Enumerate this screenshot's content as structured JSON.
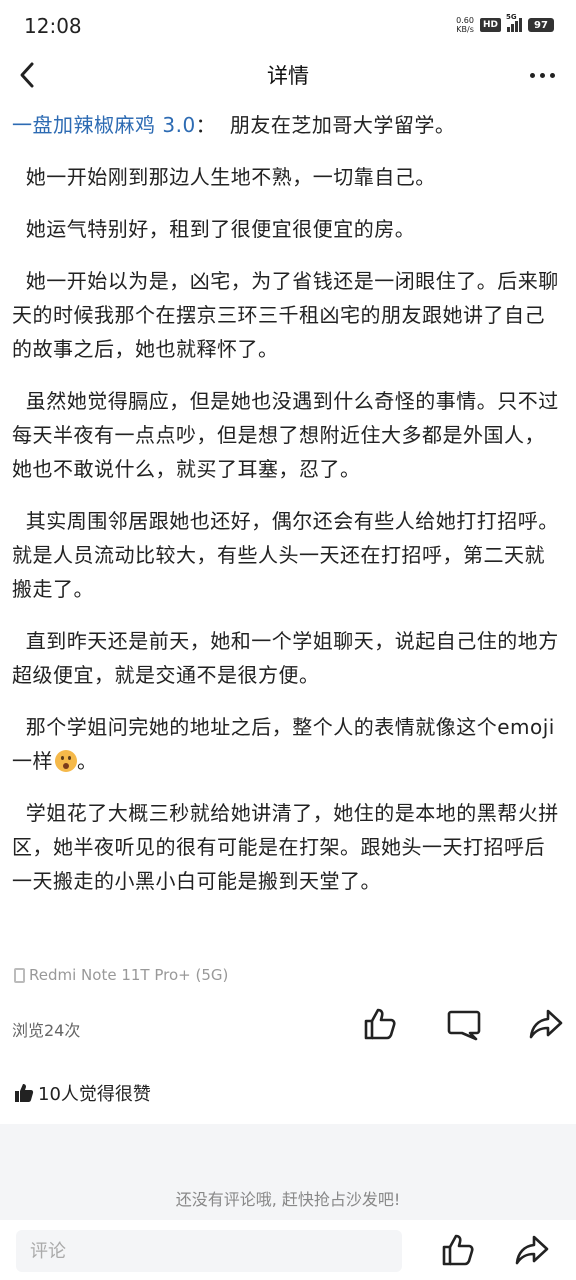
{
  "status_bar": {
    "time": "12:08",
    "net_speed_value": "0.60",
    "net_speed_unit": "KB/s",
    "hd_label": "HD",
    "network_label": "5G",
    "battery": "97"
  },
  "nav": {
    "title": "详情"
  },
  "post": {
    "author": "一盘加辣椒麻鸡 3.0",
    "separator": "：",
    "paragraphs": [
      "朋友在芝加哥大学留学。",
      "她一开始刚到那边人生地不熟，一切靠自己。",
      "她运气特别好，租到了很便宜很便宜的房。",
      "她一开始以为是，凶宅，为了省钱还是一闭眼住了。后来聊天的时候我那个在摆京三环三千租凶宅的朋友跟她讲了自己的故事之后，她也就释怀了。",
      "虽然她觉得膈应，但是她也没遇到什么奇怪的事情。只不过每天半夜有一点点吵，但是想了想附近住大多都是外国人，她也不敢说什么，就买了耳塞，忍了。",
      "其实周围邻居跟她也还好，偶尔还会有些人给她打打招呼。就是人员流动比较大，有些人头一天还在打招呼，第二天就搬走了。",
      "直到昨天还是前天，她和一个学姐聊天，说起自己住的地方超级便宜，就是交通不是很方便。",
      "那个学姐问完她的地址之后，整个人的表情就像这个emoji一样",
      "学姐花了大概三秒就给她讲清了，她住的是本地的黑帮火拼区，她半夜听见的很有可能是在打架。跟她头一天打招呼后一天搬走的小黑小白可能是搬到天堂了。"
    ],
    "emoji_suffix": "。",
    "device": "Redmi Note 11T Pro+ (5G)",
    "views": "浏览24次",
    "likes_text": "10人觉得很赞"
  },
  "comments": {
    "empty_text": "还没有评论哦, 赶快抢占沙发吧!",
    "input_placeholder": "评论"
  },
  "icons": {
    "back": "back-arrow-icon",
    "more": "more-dots-icon",
    "like": "thumbs-up-icon",
    "comment": "comment-bubble-icon",
    "share": "share-arrow-icon",
    "device": "phone-icon"
  },
  "colors": {
    "author": "#2d6bb3",
    "text": "#222222",
    "muted": "#999999",
    "band": "#f4f5f7"
  }
}
